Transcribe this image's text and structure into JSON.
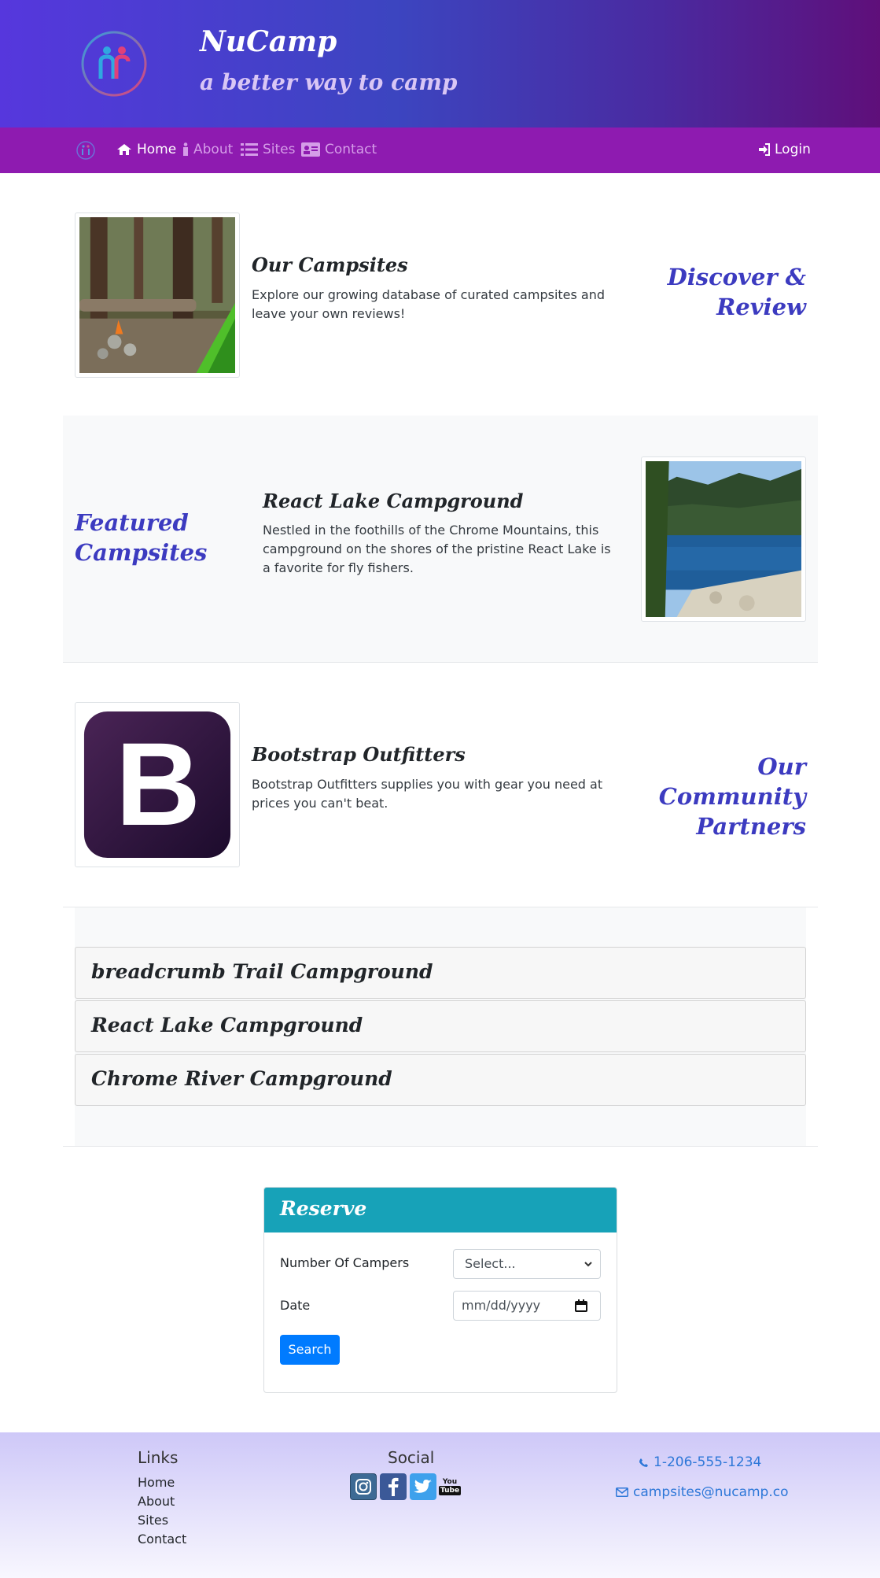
{
  "header": {
    "title": "NuCamp",
    "subtitle": "a better way to camp"
  },
  "navbar": {
    "items": [
      {
        "label": "Home",
        "icon": "home-icon",
        "active": true
      },
      {
        "label": "About",
        "icon": "info-icon",
        "active": false
      },
      {
        "label": "Sites",
        "icon": "list-icon",
        "active": false
      },
      {
        "label": "Contact",
        "icon": "address-card-icon",
        "active": false
      }
    ],
    "login_label": "Login"
  },
  "campsites": {
    "title": "Our Campsites",
    "text": "Explore our growing database of curated campsites and leave your own reviews!",
    "side_heading_line1": "Discover &",
    "side_heading_line2": "Review"
  },
  "featured": {
    "side_heading_line1": "Featured",
    "side_heading_line2": "Campsites",
    "title": "React Lake Campground",
    "text": "Nestled in the foothills of the Chrome Mountains, this campground on the shores of the pristine React Lake is a favorite for fly fishers."
  },
  "partners": {
    "title": "Bootstrap Outfitters",
    "text": "Bootstrap Outfitters supplies you with gear you need at prices you can't beat.",
    "side_heading_line1": "Our Community",
    "side_heading_line2": "Partners",
    "logo_letter": "B"
  },
  "accordion": {
    "items": [
      "breadcrumb Trail Campground",
      "React Lake Campground",
      "Chrome River Campground"
    ]
  },
  "reserve": {
    "title": "Reserve",
    "campers_label": "Number Of Campers",
    "campers_value": "Select...",
    "date_label": "Date",
    "date_placeholder": "mm/dd/yyyy",
    "search_label": "Search"
  },
  "footer": {
    "links_heading": "Links",
    "links": [
      "Home",
      "About",
      "Sites",
      "Contact"
    ],
    "social_heading": "Social",
    "social_icons": [
      "instagram-icon",
      "facebook-icon",
      "twitter-icon",
      "youtube-icon"
    ],
    "phone": "1-206-555-1234",
    "email": "campsites@nucamp.co"
  },
  "colors": {
    "navbar": "#8e1bb0",
    "accent_heading": "#3c3bc0",
    "reserve_header": "#17a2b8",
    "button": "#007bff",
    "link": "#2d77d8"
  }
}
